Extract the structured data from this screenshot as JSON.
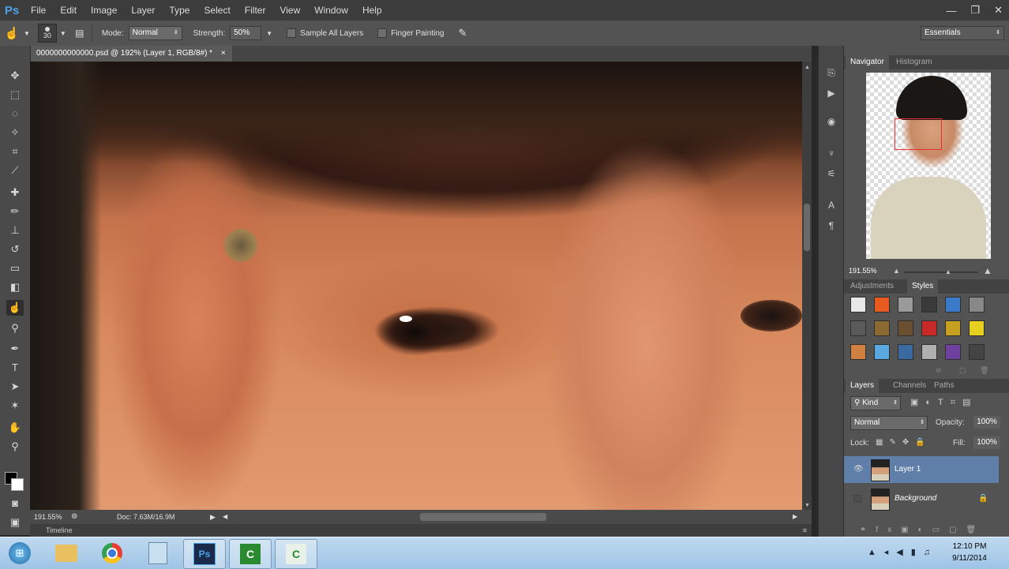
{
  "app": {
    "logo": "Ps"
  },
  "menu": [
    "File",
    "Edit",
    "Image",
    "Layer",
    "Type",
    "Select",
    "Filter",
    "View",
    "Window",
    "Help"
  ],
  "window_controls": {
    "minimize": "—",
    "restore": "❐",
    "close": "✕"
  },
  "options": {
    "brush_size": "30",
    "mode_label": "Mode:",
    "mode_value": "Normal",
    "strength_label": "Strength:",
    "strength_value": "50%",
    "sample_all_layers": "Sample All Layers",
    "finger_painting": "Finger Painting",
    "workspace": "Essentials"
  },
  "document": {
    "tab_title": "0000000000000.psd @ 192% (Layer 1, RGB/8#) *",
    "close": "×",
    "zoom": "191.55%",
    "doc_size": "Doc: 7.63M/16.9M"
  },
  "timeline": {
    "label": "Timeline"
  },
  "navigator": {
    "tabs": [
      "Navigator",
      "Histogram"
    ],
    "zoom": "191.55%"
  },
  "styles_panel": {
    "tabs": [
      "Adjustments",
      "Styles"
    ],
    "swatches": [
      "#e8e8e8",
      "#e85a20",
      "#9a9a9a",
      "#3a3a3a",
      "#3a7ac8",
      "#888888",
      "#5a5a5a",
      "#8a6a30",
      "#6a5030",
      "#c82a2a",
      "#c8a020",
      "#e8d020",
      "#d08040",
      "#5aa8e0",
      "#3a6aa0",
      "#b0b0b0",
      "#7040a0",
      "#444444"
    ]
  },
  "layers": {
    "tabs": [
      "Layers",
      "Channels",
      "Paths"
    ],
    "kind_label": "Kind",
    "blend_mode": "Normal",
    "opacity_label": "Opacity:",
    "opacity_value": "100%",
    "lock_label": "Lock:",
    "fill_label": "Fill:",
    "fill_value": "100%",
    "rows": [
      {
        "name": "Layer 1",
        "visible": true,
        "selected": true
      },
      {
        "name": "Background",
        "visible": false,
        "selected": false
      }
    ]
  },
  "taskbar": {
    "time": "12:10 PM",
    "date": "9/11/2014",
    "ps_label": "Ps"
  },
  "colors": {
    "accent_blue": "#4aa3e8",
    "selection_red": "#e83030"
  }
}
